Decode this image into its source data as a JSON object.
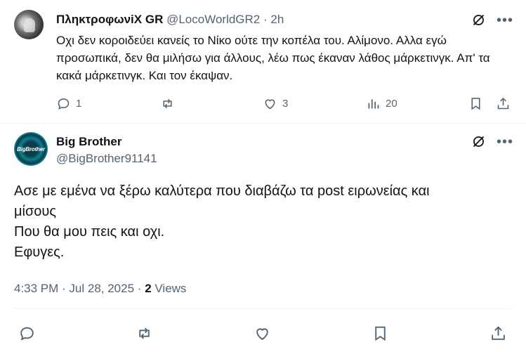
{
  "reply_tweet": {
    "display_name": "ΠληκτροφωνiX GR",
    "handle": "@LocoWorldGR2",
    "separator": "·",
    "time": "2h",
    "text": "Οχι δεν κοροιδεύει κανείς το Νίκο ούτε την κοπέλα του. Αλίμονο. Αλλα εγώ προσωπικά, δεν θα μιλήσω για άλλους, λέω πως έκαναν λάθος μάρκετινγκ. Απ' τα κακά μάρκετινγκ. Και τον έκαψαν.",
    "more": "•••",
    "actions": {
      "replies": "1",
      "reposts": "",
      "likes": "3",
      "views": "20"
    },
    "icons": [
      "grok-icon",
      "more-icon",
      "reply-icon",
      "repost-icon",
      "like-icon",
      "views-icon",
      "bookmark-icon",
      "share-icon"
    ]
  },
  "main_tweet": {
    "display_name": "Big Brother",
    "handle": "@BigBrother91141",
    "avatar_text": "BigBrother",
    "more": "•••",
    "text_lines": [
      "Ασε με εμένα να ξέρω καλύτερα που διαβάζω τα post ειρωνείας και",
      "μίσους",
      "Που θα μου πεις και οχι.",
      "Εφυγες."
    ],
    "timestamp": "4:33 PM · Jul 28, 2025",
    "meta_separator": "·",
    "views_count": "2",
    "views_label": "Views"
  },
  "colors": {
    "text": "#0f1419",
    "secondary": "#536471",
    "divider": "#eff3f4",
    "background": "#ffffff"
  }
}
